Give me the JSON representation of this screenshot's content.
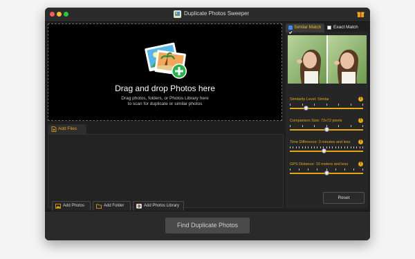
{
  "window": {
    "title": "Duplicate Photos Sweeper"
  },
  "dropzone": {
    "title": "Drag and drop Photos here",
    "subtitle_line1": "Drag photos, folders, or Photos Library here",
    "subtitle_line2": "to scan for duplicate or similar photos"
  },
  "files": {
    "tab_label": "Add Files",
    "buttons": {
      "add_photos": "Add Photos",
      "add_folder": "Add Folder",
      "add_library": "Add Photos Library"
    }
  },
  "match_tabs": {
    "similar": {
      "label": "Similar Match",
      "checked": true
    },
    "exact": {
      "label": "Exact Match",
      "checked": false
    }
  },
  "settings": {
    "similarity_level": {
      "label": "Similarity Level: ",
      "value": "Similar",
      "level": 0.22
    },
    "comparison_size": {
      "label": "Comparison Size: ",
      "value": "72x72 pixels",
      "level": 0.5
    },
    "time_difference": {
      "label": "Time Difference: ",
      "value": "3 minutes and less",
      "level": 0.47
    },
    "gps_distance": {
      "label": "GPS Distance: ",
      "value": "10 meters and less",
      "level": 0.5
    }
  },
  "reset_label": "Reset",
  "find_button_label": "Find Duplicate Photos",
  "colors": {
    "accent": "#e6a817",
    "background": "#1f1f1f",
    "checkbox_on": "#3d8bfd"
  }
}
